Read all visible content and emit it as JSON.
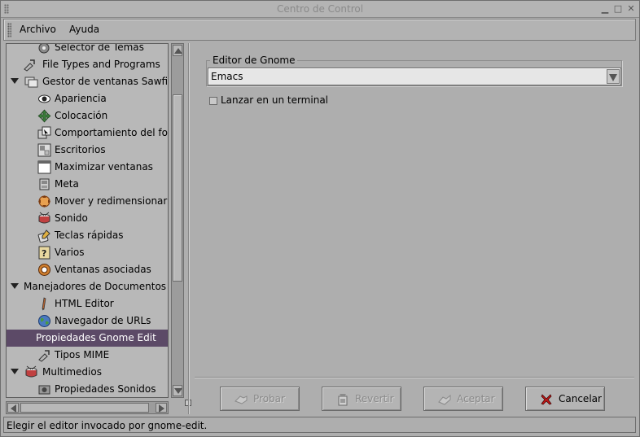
{
  "window": {
    "title": "Centro de Control",
    "controls": [
      "minimize-icon",
      "maximize-icon",
      "close-icon"
    ]
  },
  "menubar": {
    "items": [
      {
        "label": "Archivo"
      },
      {
        "label": "Ayuda"
      }
    ]
  },
  "tree": {
    "items": [
      {
        "label": "Selector de Temas",
        "icon": "theme-selector-icon"
      },
      {
        "label": "File Types and Programs",
        "icon": "file-types-icon"
      },
      {
        "label": "Gestor de ventanas Sawfish",
        "icon": "window-manager-icon",
        "expanded": true
      },
      {
        "label": "Apariencia",
        "icon": "eye-icon"
      },
      {
        "label": "Colocación",
        "icon": "placement-icon"
      },
      {
        "label": "Comportamiento del foco",
        "icon": "focus-icon"
      },
      {
        "label": "Escritorios",
        "icon": "desktops-icon"
      },
      {
        "label": "Maximizar ventanas",
        "icon": "maximize-windows-icon"
      },
      {
        "label": "Meta",
        "icon": "meta-icon"
      },
      {
        "label": "Mover y redimensionar",
        "icon": "move-resize-icon"
      },
      {
        "label": "Sonido",
        "icon": "drum-icon"
      },
      {
        "label": "Teclas rápidas",
        "icon": "shortcut-keys-icon"
      },
      {
        "label": "Varios",
        "icon": "misc-icon"
      },
      {
        "label": "Ventanas asociadas",
        "icon": "associated-windows-icon"
      },
      {
        "label": "Manejadores de Documentos",
        "icon": "",
        "expanded": true
      },
      {
        "label": "HTML Editor",
        "icon": "html-editor-icon"
      },
      {
        "label": "Navegador de URLs",
        "icon": "url-browser-icon"
      },
      {
        "label": "Propiedades Gnome Edit",
        "icon": "",
        "selected": true
      },
      {
        "label": "Tipos MIME",
        "icon": "mime-types-icon"
      },
      {
        "label": "Multimedios",
        "icon": "multimedia-icon",
        "expanded": true
      },
      {
        "label": "Propiedades Sonidos",
        "icon": "sound-properties-icon"
      }
    ]
  },
  "editor": {
    "group_label": "Editor de Gnome",
    "selected_value": "Emacs",
    "terminal_label": "Lanzar en un terminal",
    "terminal_checked": false
  },
  "buttons": [
    {
      "label": "Probar",
      "icon": "try-icon",
      "enabled": false
    },
    {
      "label": "Revertir",
      "icon": "revert-icon",
      "enabled": false
    },
    {
      "label": "Aceptar",
      "icon": "accept-icon",
      "enabled": false
    },
    {
      "label": "Cancelar",
      "icon": "cancel-icon",
      "enabled": true
    }
  ],
  "status": {
    "text": "Elegir el editor invocado por gnome-edit."
  },
  "colors": {
    "selection": "#5c4a67",
    "window_bg": "#aeaeae"
  }
}
